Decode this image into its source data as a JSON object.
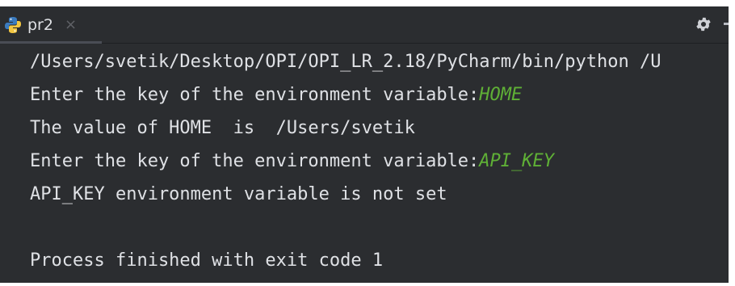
{
  "tab": {
    "label": "pr2",
    "close_glyph": "×",
    "icon": "python-icon"
  },
  "toolbar": {
    "settings_icon": "gear-icon"
  },
  "console": {
    "lines": [
      {
        "text": "/Users/svetik/Desktop/OPI/OPI_LR_2.18/PyCharm/bin/python /U",
        "input": ""
      },
      {
        "text": "Enter the key of the environment variable:",
        "input": "HOME"
      },
      {
        "text": "The value of HOME  is  /Users/svetik",
        "input": ""
      },
      {
        "text": "Enter the key of the environment variable:",
        "input": "API_KEY"
      },
      {
        "text": "API_KEY environment variable is not set",
        "input": ""
      },
      {
        "text": "",
        "input": ""
      },
      {
        "text": "Process finished with exit code 1",
        "input": ""
      }
    ]
  },
  "colors": {
    "background": "#2b2d30",
    "text": "#dfe1e5",
    "user_input": "#5fb036"
  }
}
